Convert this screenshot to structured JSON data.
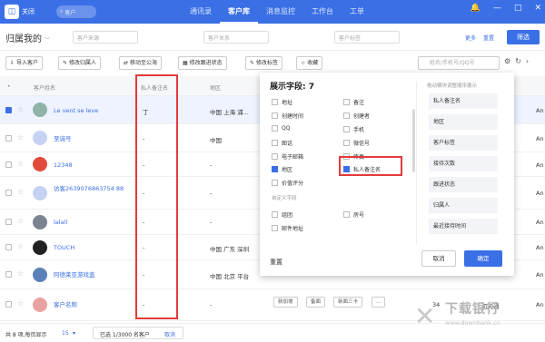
{
  "topbar": {
    "close_label": "关闭",
    "search_placeholder": "客户",
    "tabs": [
      "通讯录",
      "客户库",
      "消息监控",
      "工作台",
      "工单"
    ],
    "active_tab": "客户库"
  },
  "filterbar": {
    "belong_label": "归属我的",
    "filters": [
      {
        "label": "客户来源",
        "placeholder": "选择"
      },
      {
        "label": "客户关系",
        "placeholder": "选择"
      },
      {
        "label": "客户标签",
        "placeholder": "选择"
      }
    ],
    "more_label": "更多",
    "reset_label": "重置",
    "filter_button": "筛选"
  },
  "toolbar": {
    "buttons": [
      "导入客户",
      "修改归属人",
      "移动至公海",
      "修改跟进状态",
      "修改标签",
      "收藏"
    ],
    "search_placeholder": "姓名/手机号/QQ号"
  },
  "table": {
    "headers": {
      "name": "客户姓名",
      "note": "私人备注名",
      "region": "地区"
    },
    "rows": [
      {
        "name": "Le vent se leve",
        "note": "丁",
        "region": "中国 上海 浦...",
        "selected": true,
        "edge": "An"
      },
      {
        "name": "至诚号",
        "note": "-",
        "region": "中国",
        "selected": false,
        "edge": "An"
      },
      {
        "name": "12348",
        "note": "-",
        "region": "-",
        "selected": false,
        "edge": "An"
      },
      {
        "name": "访客2639076863754 88",
        "note": "-",
        "region": "-",
        "selected": false,
        "edge": "An"
      },
      {
        "name": "lalall",
        "note": "-",
        "region": "-",
        "selected": false,
        "edge": "An"
      },
      {
        "name": "TOUCH",
        "note": "-",
        "region": "中国 广东 深圳",
        "selected": false,
        "edge": "An"
      },
      {
        "name": "阿德莱亚游戏盖",
        "note": "-",
        "region": "中国 北京 平台",
        "selected": false,
        "edge": "An"
      },
      {
        "name": "客户名称",
        "note": "-",
        "region": "-",
        "selected": false,
        "edge": "An"
      }
    ],
    "last_row_tags": [
      "新加坡",
      "备面",
      "新面三卡",
      "..."
    ],
    "last_row_extra": [
      "34",
      "初沟通"
    ]
  },
  "panel": {
    "title": "展示字段: 7",
    "options": [
      {
        "label": "地址",
        "checked": false
      },
      {
        "label": "备注",
        "checked": false
      },
      {
        "label": "创建时间",
        "checked": false
      },
      {
        "label": "创建者",
        "checked": false
      },
      {
        "label": "QQ",
        "checked": false
      },
      {
        "label": "手机",
        "checked": false
      },
      {
        "label": "图话",
        "checked": false
      },
      {
        "label": "微信号",
        "checked": false
      },
      {
        "label": "电子邮箱",
        "checked": false
      },
      {
        "label": "传真",
        "checked": false
      },
      {
        "label": "地区",
        "checked": true
      },
      {
        "label": "私人备注名",
        "checked": true
      },
      {
        "label": "价值评分",
        "checked": false
      }
    ],
    "custom_heading": "自定义字段",
    "custom_options": [
      {
        "label": "组团",
        "checked": false
      },
      {
        "label": "房号",
        "checked": false
      },
      {
        "label": "邮件地址",
        "checked": false
      }
    ],
    "right_heading": "拖动模块调整顺序展示",
    "right_items": [
      "私人备注名",
      "地区",
      "客户标签",
      "接待次数",
      "跟进状态",
      "归属人",
      "最近接待时间"
    ],
    "reset_label": "重置",
    "cancel_label": "取消",
    "ok_label": "确定"
  },
  "footer": {
    "total": "共 8 项,每页显示",
    "per_page": "15",
    "selected": "已选 1/3000 名客户",
    "cancel": "取消"
  },
  "watermark": {
    "big": "下载银行",
    "small": "www.downbank.cn"
  },
  "colors": {
    "primary": "#3a6fe6",
    "highlight": "#e23b3b"
  }
}
